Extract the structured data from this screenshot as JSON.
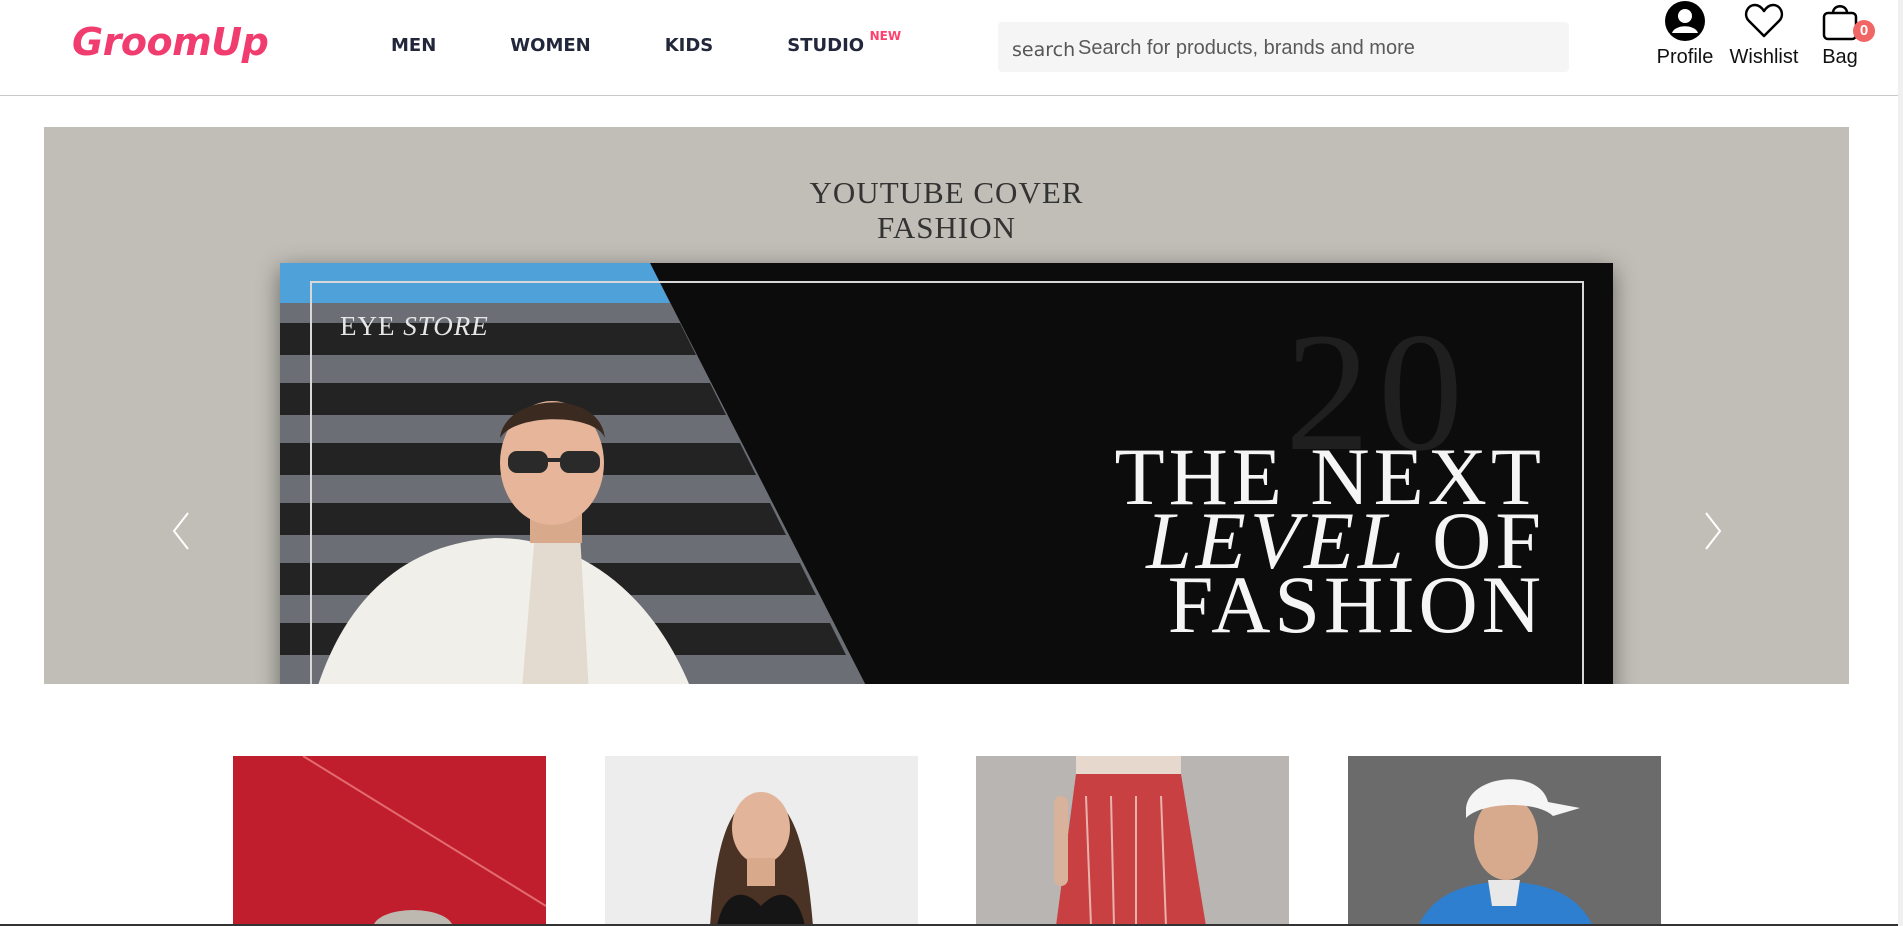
{
  "brand": {
    "logo": "GroomUp",
    "accent": "#f13c70"
  },
  "nav": {
    "items": [
      {
        "label": "MEN"
      },
      {
        "label": "WOMEN"
      },
      {
        "label": "KIDS"
      },
      {
        "label": "STUDIO",
        "badge": "NEW"
      }
    ]
  },
  "search": {
    "label": "search",
    "placeholder": "Search for products, brands and more"
  },
  "actions": {
    "profile": {
      "label": "Profile",
      "icon": "user-circle-icon"
    },
    "wishlist": {
      "label": "Wishlist",
      "icon": "heart-icon"
    },
    "bag": {
      "label": "Bag",
      "icon": "shopping-bag-icon",
      "count": "0"
    }
  },
  "banner": {
    "title_line1": "YOUTUBE COVER",
    "title_line2": "FASHION",
    "store_name_plain": "EYE ",
    "store_name_italic": "STORE",
    "watermark": "20",
    "headline_line1": "THE NEXT",
    "headline_italic": "LEVEL",
    "headline_line2_rest": " OF",
    "headline_line3": "FASHION",
    "prev_icon": "chevron-left-icon",
    "next_icon": "chevron-right-icon"
  },
  "tiles": [
    {
      "name": "accessories"
    },
    {
      "name": "womens-top"
    },
    {
      "name": "womens-skirt"
    },
    {
      "name": "mens-sportswear"
    }
  ]
}
